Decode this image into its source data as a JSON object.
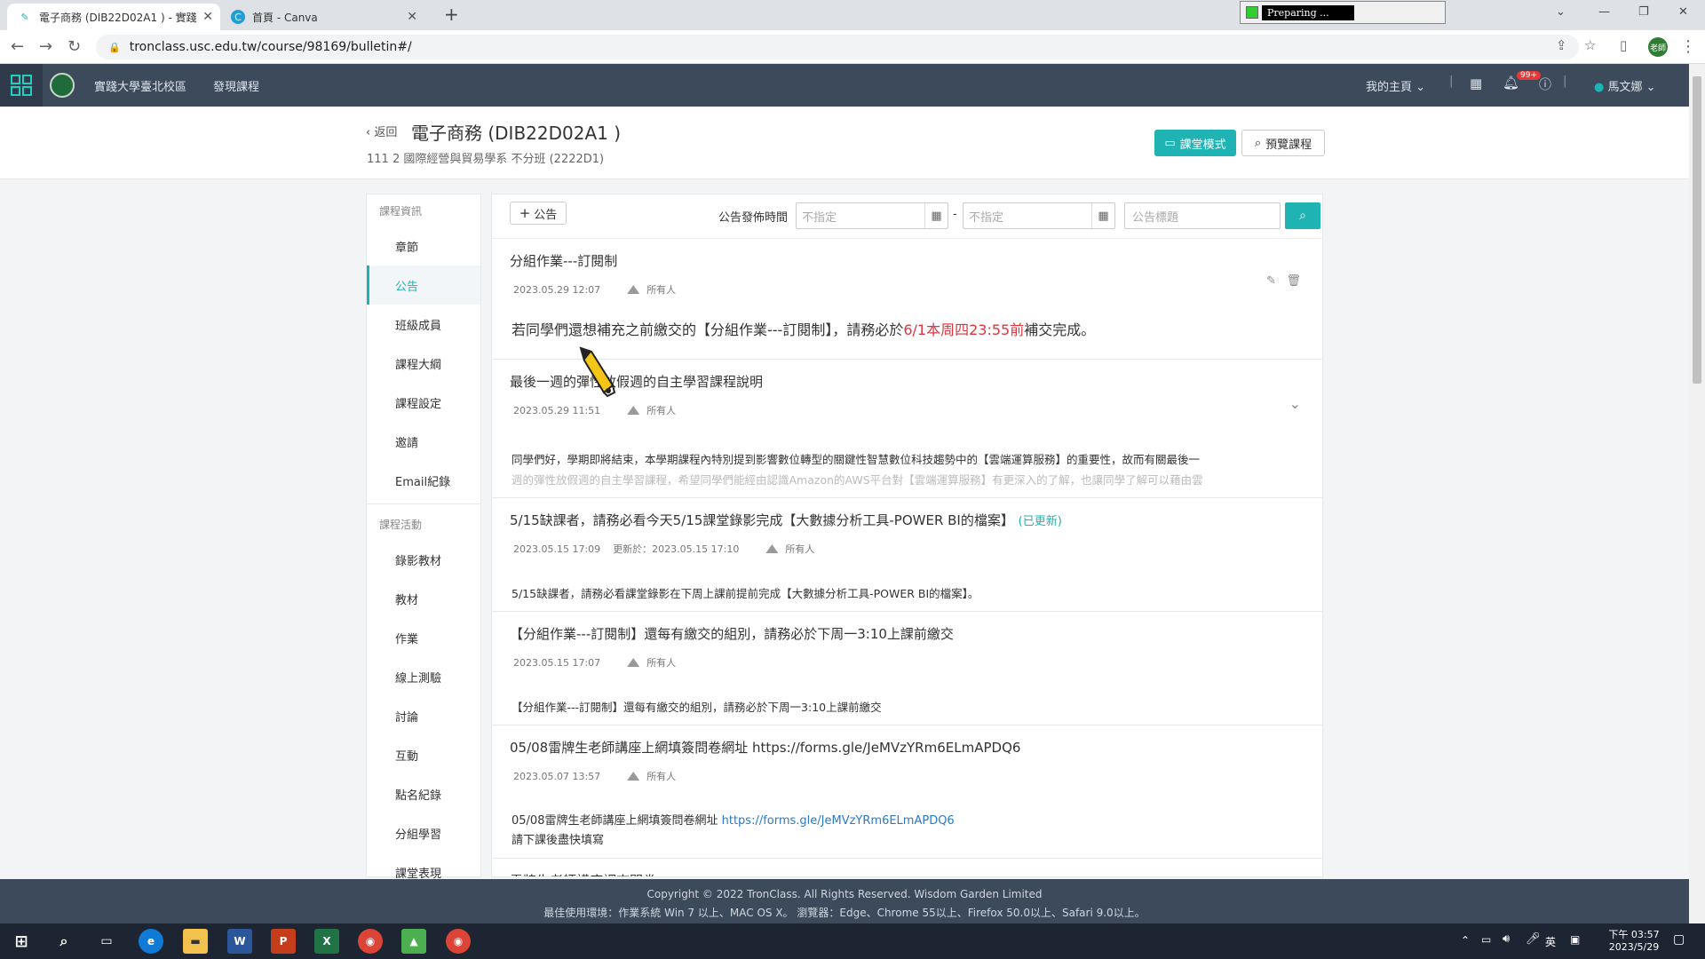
{
  "browser": {
    "tabs": [
      {
        "title": "電子商務 (DIB22D02A1 ) - 實踐",
        "active": true
      },
      {
        "title": "首頁 - Canva",
        "active": false
      }
    ],
    "url": "tronclass.usc.edu.tw/course/98169/bulletin#/",
    "preparing": "Preparing ...",
    "new_tab": "+"
  },
  "app_header": {
    "school": "實踐大學臺北校區",
    "discover": "發現課程",
    "my_home": "我的主頁",
    "notif_badge": "99+",
    "user": "馬文娜",
    "avatar_label": "老師"
  },
  "course": {
    "back": "返回",
    "title": "電子商務 (DIB22D02A1 )",
    "subtitle": "111 2 國際經營與貿易學系 不分班 (2222D1)",
    "class_mode": "課堂模式",
    "preview": "預覽課程"
  },
  "sidebar": {
    "group1": "課程資訊",
    "items1": [
      "章節",
      "公告",
      "班級成員",
      "課程大綱",
      "課程設定",
      "邀請",
      "Email紀錄"
    ],
    "group2": "課程活動",
    "items2": [
      "錄影教材",
      "教材",
      "作業",
      "線上測驗",
      "討論",
      "互動",
      "點名紀錄",
      "分組學習",
      "課堂表現"
    ]
  },
  "toolbar": {
    "add": "公告",
    "pub_label": "公告發佈時間",
    "start_placeholder": "不指定",
    "end_placeholder": "不指定",
    "dash": "-",
    "title_placeholder": "公告標題"
  },
  "posts": [
    {
      "title": "分組作業---訂閱制",
      "date": "2023.05.29 12:07",
      "audience": "所有人",
      "body_pre": "若同學們還想補充之前繳交的【分組作業---訂閱制】，請務必於",
      "body_red": "6/1本周四23:55前",
      "body_post": "補交完成。"
    },
    {
      "title": "最後一週的彈性放假週的自主學習課程說明",
      "date": "2023.05.29 11:51",
      "audience": "所有人",
      "body_line1": "同學們好，學期即將結束，本學期課程內特別提到影響數位轉型的關鍵性智慧數位科技趨勢中的【雲端運算服務】的重要性，故而有關最後一",
      "body_line2": "週的彈性放假週的自主學習課程，希望同學們能經由認識Amazon的AWS平台對【雲端運算服務】有更深入的了解，也讓同學了解可以藉由雲"
    },
    {
      "title": "5/15缺課者，請務必看今天5/15課堂錄影完成【大數據分析工具-POWER BI的檔案】",
      "updated_tag": "(已更新)",
      "date": "2023.05.15 17:09",
      "updated_at": "更新於：2023.05.15 17:10",
      "audience": "所有人",
      "body": "5/15缺課者，請務必看課堂錄影在下周上課前提前完成【大數據分析工具-POWER BI的檔案】。"
    },
    {
      "title": "【分組作業---訂閱制】還每有繳交的組別，請務必於下周一3:10上課前繳交",
      "date": "2023.05.15 17:07",
      "audience": "所有人",
      "body": "【分組作業---訂閱制】還每有繳交的組別，請務必於下周一3:10上課前繳交"
    },
    {
      "title": "05/08雷牌生老師講座上網填簽問卷網址 https://forms.gle/JeMVzYRm6ELmAPDQ6",
      "date": "2023.05.07 13:57",
      "audience": "所有人",
      "body_pre": "05/08雷牌生老師講座上網填簽問卷網址",
      "body_link": "https://forms.gle/JeMVzYRm6ELmAPDQ6",
      "body_line2": "請下課後盡快填寫"
    }
  ],
  "partial_post_title": "雷牌生老師講座調查問卷",
  "footer": {
    "line1": "Copyright © 2022 TronClass. All Rights Reserved. Wisdom Garden Limited",
    "line2": "最佳使用環境：作業系統 Win 7 以上、MAC OS X。 瀏覽器：Edge、Chrome 55以上、Firefox 50.0以上、Safari 9.0以上。"
  },
  "taskbar": {
    "time": "下午 03:57",
    "date": "2023/5/29",
    "ime": "英"
  }
}
